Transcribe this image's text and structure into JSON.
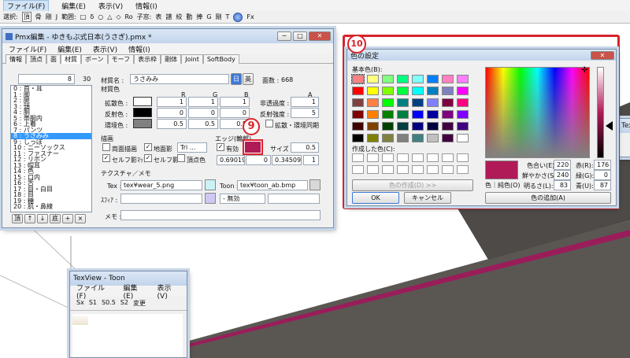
{
  "topbar": {
    "menu": [
      "ファイル(F)",
      "編集(E)",
      "表示(V)",
      "情報(I)"
    ],
    "toolbar": [
      "選択:",
      "頂",
      "骨",
      "剛",
      "J",
      "範囲:",
      "□",
      "δ",
      "○",
      "△",
      "◇",
      "Ro",
      "子窓:",
      "表",
      "譜",
      "絞",
      "動",
      "捧",
      "G",
      "剛",
      "T",
      "Fx"
    ]
  },
  "pmx": {
    "title": "Pmx編集 - ゆきもぶ式日本(うさぎ).pmx *",
    "menu": [
      "ファイル(F)",
      "編集(E)",
      "表示(V)",
      "情報(I)"
    ],
    "tabs": [
      "情報",
      "頂点",
      "面",
      "材質",
      "ボーン",
      "モーフ",
      "表示枠",
      "剛体",
      "Joint",
      "SoftBody"
    ],
    "list_top": "8",
    "list_count": "30",
    "list_items": [
      "0 : 首・耳",
      "1 : 脚",
      "2 : 腿",
      "3 : 頭",
      "4 : 胴",
      "5 : 帯胴内",
      "6 : 上着",
      "7 : パンツ",
      "8 : うさみみ",
      "9 : しっぽ",
      "10 : ニーソックス",
      "11 : ファスナー",
      "12 : リボン",
      "13 : 帽耳",
      "14 : 色",
      "15 : 口内",
      "16 : 舌",
      "17 : 目・白目",
      "18 : 目",
      "19 : 糖",
      "20 : 肌・鼻線"
    ],
    "list_buttons": [
      "頂",
      "↑",
      "↓",
      "底",
      "+",
      "×"
    ],
    "material_name_label": "材質名 :",
    "material_name": "うさみみ",
    "lang_jp": "日",
    "lang_en": "英",
    "face_count_label": "面数 :",
    "face_count": "668",
    "material_color_label": "材質色",
    "headers": [
      "R",
      "G",
      "B",
      "A"
    ],
    "diffuse_label": "拡散色 :",
    "diffuse": [
      "1",
      "1",
      "1"
    ],
    "specular_label": "反射色 :",
    "specular": [
      "0",
      "0",
      "0"
    ],
    "ambient_label": "環境色 :",
    "ambient": [
      "0.5",
      "0.5",
      "0.5"
    ],
    "alpha_label": "非透過度 :",
    "alpha": "1",
    "spec_power_label": "反射強度 :",
    "spec_power": "5",
    "diffuse_env_label": "拡散・環境同期",
    "draw_label": "描画",
    "two_sided": "両面描画",
    "ground_shadow": "地面影",
    "tri_value": "Tri ...",
    "self_shadow_map": "セルフ影ﾏｯﾌﾟ",
    "self_shadow": "セルフ影",
    "vertex_color": "頂点色",
    "edge_label": "エッジ(輪郭)",
    "edge_enabled": "有効",
    "edge_size_label": "サイズ :",
    "edge_size": "0.5",
    "edge_values": [
      "0.690196",
      "0",
      "0.345098",
      "1"
    ],
    "texture_label": "テクスチャ／メモ",
    "tex_label": "Tex :",
    "tex_value": "tex¥wear_5.png",
    "toon_label": "Toon :",
    "toon_value": "tex¥toon_ab.bmp",
    "sphere_label": "ｽﾌｨｱ :",
    "sphere_mode": "- 無効",
    "memo_label": "メモ :",
    "colors": {
      "edge": "#b01a57",
      "tex_swatch": "#c9f3f5",
      "sphere_swatch": "#cfc8f4"
    }
  },
  "texview": {
    "title": "TexView - Toon",
    "menu": [
      "ファイル(F)",
      "編集(E)",
      "表示(V)"
    ],
    "toolbar": [
      "Sx",
      "S1",
      "S0.5",
      "S2",
      "変更"
    ]
  },
  "color_dialog": {
    "title": "色の設定",
    "basic_label": "基本色(B):",
    "custom_label": "作成した色(C):",
    "define_button": "色の作成(D) >>",
    "ok": "OK",
    "cancel": "キャンセル",
    "solid_label": "色｜純色(O)",
    "add_button": "色の追加(A)",
    "hue_label": "色合い(E):",
    "hue": "220",
    "sat_label": "鮮やかさ(S):",
    "sat": "240",
    "lum_label": "明るさ(L):",
    "lum": "83",
    "red_label": "赤(R):",
    "red": "176",
    "green_label": "緑(G):",
    "green": "0",
    "blue_label": "青(U):",
    "blue": "87",
    "selected_color": "#b01a57",
    "basic_colors": [
      "#ff8080",
      "#ffff80",
      "#80ff80",
      "#00ff80",
      "#80ffff",
      "#0080ff",
      "#ff80c0",
      "#ff80ff",
      "#ff0000",
      "#ffff00",
      "#80ff00",
      "#00ff40",
      "#00ffff",
      "#0080c0",
      "#8080c0",
      "#ff00ff",
      "#804040",
      "#ff8040",
      "#00ff00",
      "#008080",
      "#004080",
      "#8080ff",
      "#800040",
      "#ff0080",
      "#800000",
      "#ff8000",
      "#008000",
      "#008040",
      "#0000ff",
      "#0000a0",
      "#800080",
      "#8000ff",
      "#400000",
      "#804000",
      "#004000",
      "#004040",
      "#000080",
      "#000040",
      "#400040",
      "#400080",
      "#000000",
      "#808000",
      "#808040",
      "#808080",
      "#408080",
      "#c0c0c0",
      "#400040",
      "#ffffff"
    ]
  },
  "side_window": {
    "title": "TexVie"
  },
  "callouts": {
    "nine": "9",
    "ten": "10"
  }
}
